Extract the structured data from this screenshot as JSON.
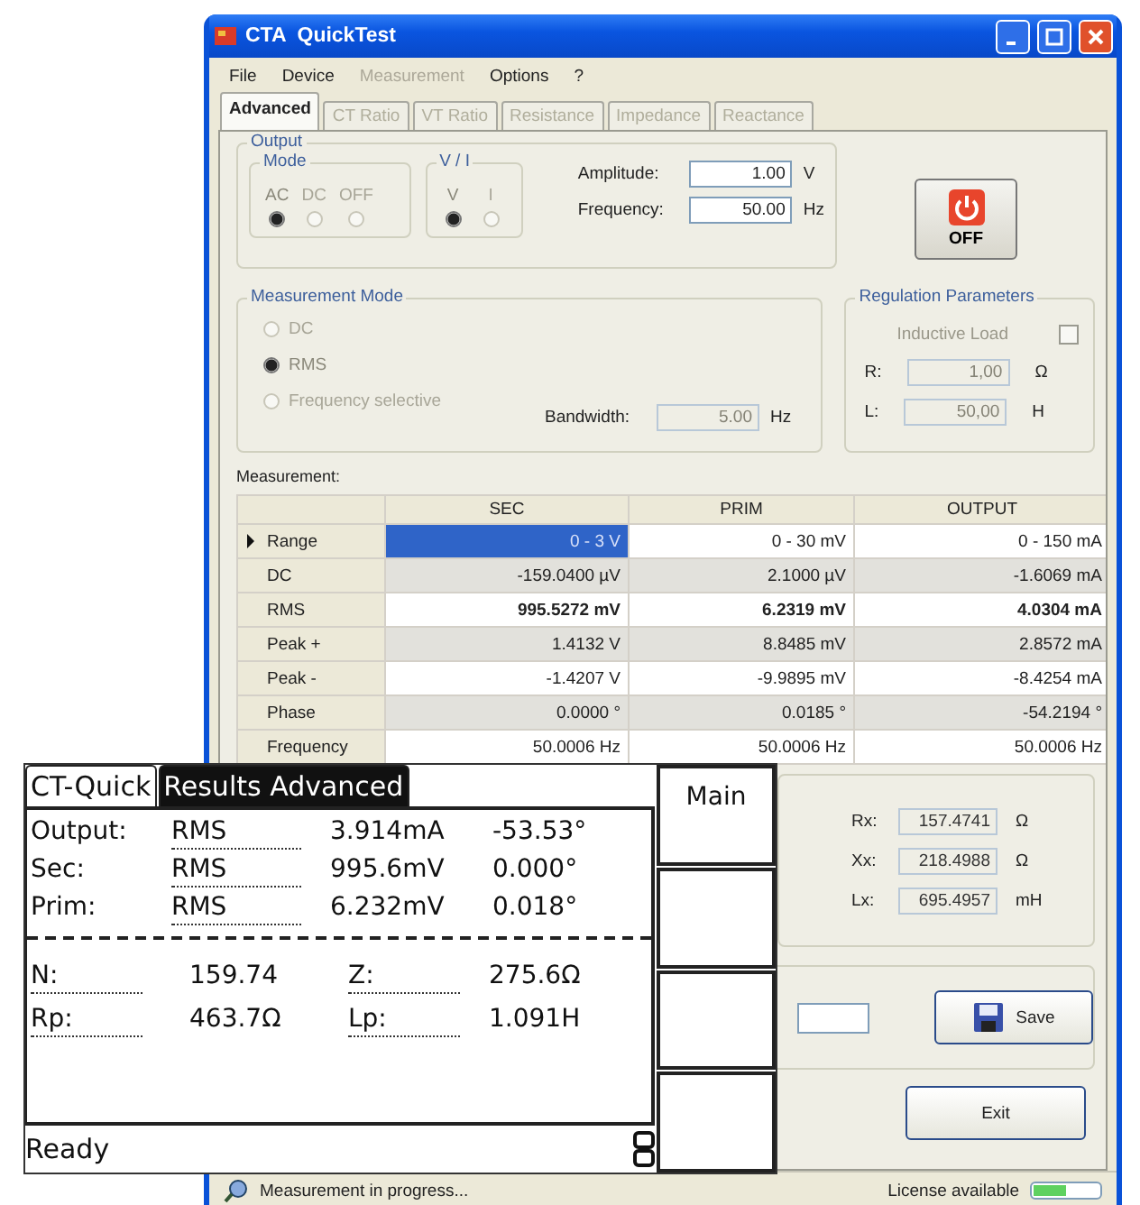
{
  "window": {
    "title": "CTA  QuickTest"
  },
  "menu": [
    {
      "label": "File",
      "disabled": false
    },
    {
      "label": "Device",
      "disabled": false
    },
    {
      "label": "Measurement",
      "disabled": true
    },
    {
      "label": "Options",
      "disabled": false
    },
    {
      "label": "?",
      "disabled": false
    }
  ],
  "tabs": [
    {
      "label": "Advanced",
      "selected": true,
      "disabled": false
    },
    {
      "label": "CT Ratio",
      "selected": false,
      "disabled": true
    },
    {
      "label": "VT Ratio",
      "selected": false,
      "disabled": true
    },
    {
      "label": "Resistance",
      "selected": false,
      "disabled": true
    },
    {
      "label": "Impedance",
      "selected": false,
      "disabled": true
    },
    {
      "label": "Reactance",
      "selected": false,
      "disabled": true
    }
  ],
  "output": {
    "title": "Output",
    "mode": {
      "title": "Mode",
      "options": [
        {
          "label": "AC",
          "selected": true
        },
        {
          "label": "DC",
          "selected": false
        },
        {
          "label": "OFF",
          "selected": false
        }
      ]
    },
    "vi": {
      "title": "V / I",
      "options": [
        {
          "label": "V",
          "selected": true
        },
        {
          "label": "I",
          "selected": false
        }
      ]
    },
    "fields": [
      {
        "label": "Amplitude:",
        "value": "1.00",
        "unit": "V"
      },
      {
        "label": "Frequency:",
        "value": "50.00",
        "unit": "Hz"
      }
    ],
    "power_button": {
      "label": "OFF",
      "on": false
    }
  },
  "measurement_mode": {
    "title": "Measurement Mode",
    "options": [
      {
        "label": "DC",
        "selected": false
      },
      {
        "label": "RMS",
        "selected": true
      },
      {
        "label": "Frequency selective",
        "selected": false
      }
    ],
    "bandwidth": {
      "label": "Bandwidth:",
      "value": "5.00",
      "unit": "Hz",
      "disabled": true
    }
  },
  "regulation": {
    "title": "Regulation Parameters",
    "inductive_load": {
      "label": "Inductive Load",
      "checked": false
    },
    "fields": [
      {
        "label": "R:",
        "value": "1,00",
        "unit": "Ω",
        "disabled": true
      },
      {
        "label": "L:",
        "value": "50,00",
        "unit": "H",
        "disabled": true
      }
    ]
  },
  "measurement": {
    "label": "Measurement:",
    "columns": [
      "SEC",
      "PRIM",
      "OUTPUT"
    ],
    "rows": [
      {
        "label": "Range",
        "current": true,
        "bold": false,
        "cells": [
          {
            "text": "0 - 3 V",
            "selected": true
          },
          {
            "text": "0 - 30 mV",
            "selected": false
          },
          {
            "text": "0 - 150 mA",
            "selected": false
          }
        ]
      },
      {
        "label": "DC",
        "current": false,
        "bold": false,
        "cells": [
          {
            "text": "-159.0400 µV",
            "selected": false
          },
          {
            "text": "2.1000 µV",
            "selected": false
          },
          {
            "text": "-1.6069 mA",
            "selected": false
          }
        ]
      },
      {
        "label": "RMS",
        "current": false,
        "bold": true,
        "cells": [
          {
            "text": "995.5272 mV",
            "selected": false
          },
          {
            "text": "6.2319 mV",
            "selected": false
          },
          {
            "text": "4.0304 mA",
            "selected": false
          }
        ]
      },
      {
        "label": "Peak +",
        "current": false,
        "bold": false,
        "cells": [
          {
            "text": "1.4132 V",
            "selected": false
          },
          {
            "text": "8.8485 mV",
            "selected": false
          },
          {
            "text": "2.8572 mA",
            "selected": false
          }
        ]
      },
      {
        "label": "Peak -",
        "current": false,
        "bold": false,
        "cells": [
          {
            "text": "-1.4207 V",
            "selected": false
          },
          {
            "text": "-9.9895 mV",
            "selected": false
          },
          {
            "text": "-8.4254 mA",
            "selected": false
          }
        ]
      },
      {
        "label": "Phase",
        "current": false,
        "bold": false,
        "cells": [
          {
            "text": "0.0000 °",
            "selected": false
          },
          {
            "text": "0.0185 °",
            "selected": false
          },
          {
            "text": "-54.2194 °",
            "selected": false
          }
        ]
      },
      {
        "label": "Frequency",
        "current": false,
        "bold": false,
        "cells": [
          {
            "text": "50.0006 Hz",
            "selected": false
          },
          {
            "text": "50.0006 Hz",
            "selected": false
          },
          {
            "text": "50.0006 Hz",
            "selected": false
          }
        ]
      }
    ]
  },
  "results": {
    "fields": [
      {
        "label": "Rx:",
        "value": "157.4741",
        "unit": "Ω"
      },
      {
        "label": "Xx:",
        "value": "218.4988",
        "unit": "Ω"
      },
      {
        "label": "Lx:",
        "value": "695.4957",
        "unit": "mH"
      }
    ]
  },
  "save_button": {
    "label": "Save"
  },
  "exit_button": {
    "label": "Exit"
  },
  "status_bar": {
    "message": "Measurement in progress...",
    "license": {
      "label": "License available",
      "level": 0.5
    }
  },
  "lcd": {
    "tabs": [
      {
        "label": "CT-Quick",
        "selected": false
      },
      {
        "label": "Results Advanced",
        "selected": true
      }
    ],
    "rows": [
      {
        "label": "Output:",
        "mode": "RMS",
        "value": "3.914mA",
        "phase": "-53.53°"
      },
      {
        "label": "Sec:",
        "mode": "RMS",
        "value": "995.6mV",
        "phase": "0.000°"
      },
      {
        "label": "Prim:",
        "mode": "RMS",
        "value": "6.232mV",
        "phase": "0.018°"
      }
    ],
    "params": [
      {
        "label": "N:",
        "value": "159.74"
      },
      {
        "label": "Z:",
        "value": "275.6Ω"
      },
      {
        "label": "Rp:",
        "value": "463.7Ω"
      },
      {
        "label": "Lp:",
        "value": "1.091H"
      }
    ],
    "status": "Ready",
    "softkeys": [
      {
        "kind": "labeled",
        "label": "Main"
      },
      {
        "kind": "blank"
      },
      {
        "kind": "blank"
      },
      {
        "kind": "blank"
      }
    ]
  }
}
